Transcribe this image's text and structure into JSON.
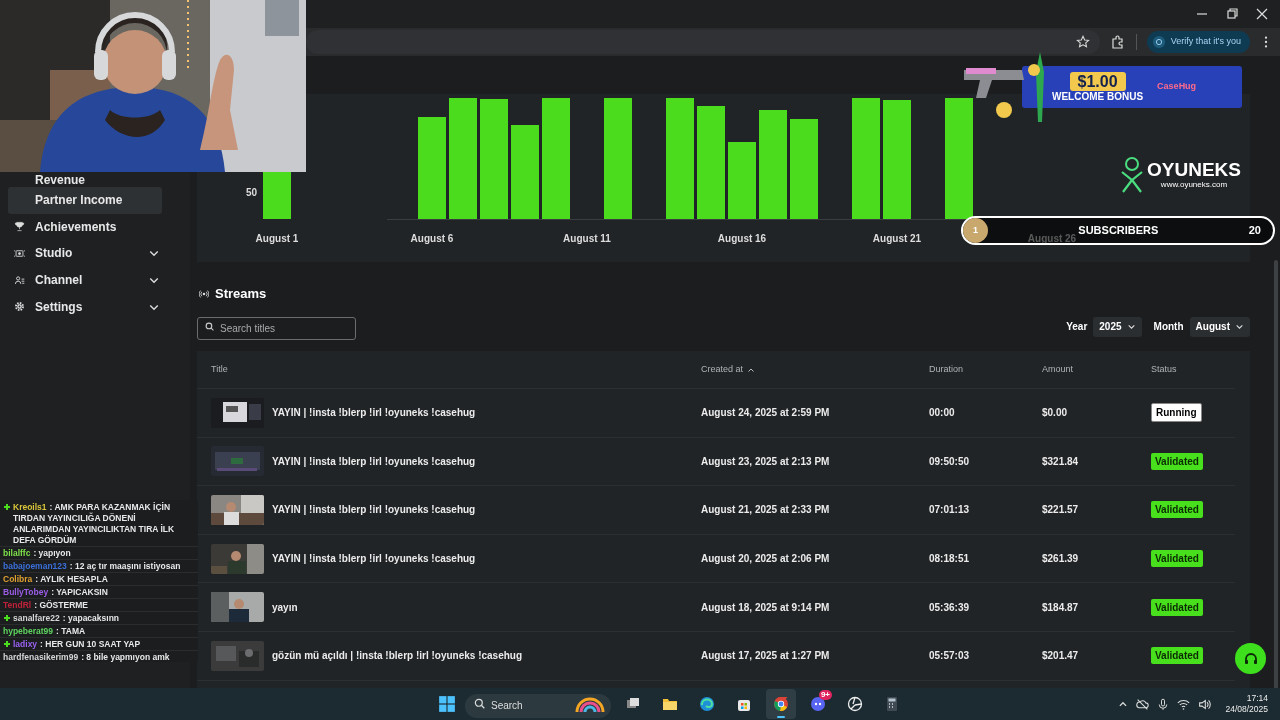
{
  "browser": {
    "verify_button": "Verify that it's you"
  },
  "sidebar": {
    "items": [
      {
        "label": "Revenue",
        "kind": "sub",
        "selected": false
      },
      {
        "label": "Partner Income",
        "kind": "sub",
        "selected": true
      },
      {
        "label": "Achievements",
        "kind": "link",
        "selected": false
      },
      {
        "label": "Studio",
        "kind": "group",
        "selected": false
      },
      {
        "label": "Channel",
        "kind": "group",
        "selected": false
      },
      {
        "label": "Settings",
        "kind": "group",
        "selected": false
      }
    ]
  },
  "chart": {
    "y_tick": "50",
    "x_labels": [
      "August 1",
      "August 6",
      "August 11",
      "August 16",
      "August 21",
      "August 26"
    ]
  },
  "streams": {
    "title": "Streams",
    "search": {
      "placeholder": "Search titles"
    },
    "filters": [
      {
        "label": "Year",
        "value": "2025"
      },
      {
        "label": "Month",
        "value": "August"
      }
    ],
    "table": {
      "columns": [
        {
          "label": "Title",
          "sorted": false
        },
        {
          "label": "Created at",
          "sorted": true
        },
        {
          "label": "Duration",
          "sorted": false
        },
        {
          "label": "Amount",
          "sorted": false
        },
        {
          "label": "Status",
          "sorted": false
        }
      ],
      "rows": [
        {
          "title": "YAYIN | !insta !blerp !irl !oyuneks !casehug",
          "created": "August 24, 2025 at 2:59 PM",
          "duration": "00:00",
          "amount": "$0.00",
          "status": {
            "label": "Running",
            "kind": "running"
          }
        },
        {
          "title": "YAYIN | !insta !blerp !irl !oyuneks !casehug",
          "created": "August 23, 2025 at 2:13 PM",
          "duration": "09:50:50",
          "amount": "$321.84",
          "status": {
            "label": "Validated",
            "kind": "validated"
          }
        },
        {
          "title": "YAYIN | !insta !blerp !irl !oyuneks !casehug",
          "created": "August 21, 2025 at 2:33 PM",
          "duration": "07:01:13",
          "amount": "$221.57",
          "status": {
            "label": "Validated",
            "kind": "validated"
          }
        },
        {
          "title": "YAYIN | !insta !blerp !irl !oyuneks !casehug",
          "created": "August 20, 2025 at 2:06 PM",
          "duration": "08:18:51",
          "amount": "$261.39",
          "status": {
            "label": "Validated",
            "kind": "validated"
          }
        },
        {
          "title": "yayın",
          "created": "August 18, 2025 at 9:14 PM",
          "duration": "05:36:39",
          "amount": "$184.87",
          "status": {
            "label": "Validated",
            "kind": "validated"
          }
        },
        {
          "title": "gözün mü açıldı | !insta !blerp !irl !oyuneks !casehug",
          "created": "August 17, 2025 at 1:27 PM",
          "duration": "05:57:03",
          "amount": "$201.47",
          "status": {
            "label": "Validated",
            "kind": "validated"
          }
        }
      ]
    }
  },
  "overlay": {
    "bonus": {
      "amount": "$1.00",
      "label": "WELCOME BONUS",
      "brand": "CaseHug"
    },
    "logo": {
      "name": "OYUNEKS",
      "url": "www.oyuneks.com"
    },
    "subscribers": {
      "rank": "1",
      "label": "SUBSCRIBERS",
      "count": "20"
    }
  },
  "chat": {
    "messages": [
      {
        "user": "Kreoils1",
        "text": ": AMK PARA KAZANMAK İÇİN TIRDAN YAYINCILIĞA DÖNENİ ANLARIMDAN YAYINCILIKTAN TIRA İLK DEFA GÖRDÜM",
        "color": "#d8c43a",
        "badge": true
      },
      {
        "user": "bilalffc",
        "text": ": yapıyon",
        "color": "#7ee04a",
        "badge": false
      },
      {
        "user": "babajoeman123",
        "text": ": 12 aç tır maaşını istiyosan",
        "color": "#3b6fd8",
        "badge": false
      },
      {
        "user": "Colibra",
        "text": ": AYLIK HESAPLA",
        "color": "#e0a030",
        "badge": false
      },
      {
        "user": "BullyTobey",
        "text": ": YAPICAKSIN",
        "color": "#9b5de5",
        "badge": false
      },
      {
        "user": "TendRl",
        "text": ": GÖSTERME",
        "color": "#c0213a",
        "badge": false
      },
      {
        "user": "sanalfare22",
        "text": ": yapacaksınn",
        "color": "#d6d6d6",
        "badge": true
      },
      {
        "user": "hypeberat99",
        "text": ": TAMA",
        "color": "#5fd35f",
        "badge": false
      },
      {
        "user": "ladixy",
        "text": ": HER GUN 10 SAAT YAP",
        "color": "#9a62f2",
        "badge": true
      },
      {
        "user": "hardfenasikerim99",
        "text": ": 8 bile yapmıyon amk",
        "color": "#d6d6d6",
        "badge": false
      }
    ]
  },
  "taskbar": {
    "search_placeholder": "Search",
    "apps": [
      {
        "selected": false
      },
      {
        "selected": false
      },
      {
        "selected": false
      },
      {
        "selected": false
      },
      {
        "selected": true
      },
      {
        "selected": false,
        "badge": "9+"
      },
      {
        "selected": false
      },
      {
        "selected": false
      }
    ],
    "time": "17:14",
    "date": "24/08/2025"
  }
}
